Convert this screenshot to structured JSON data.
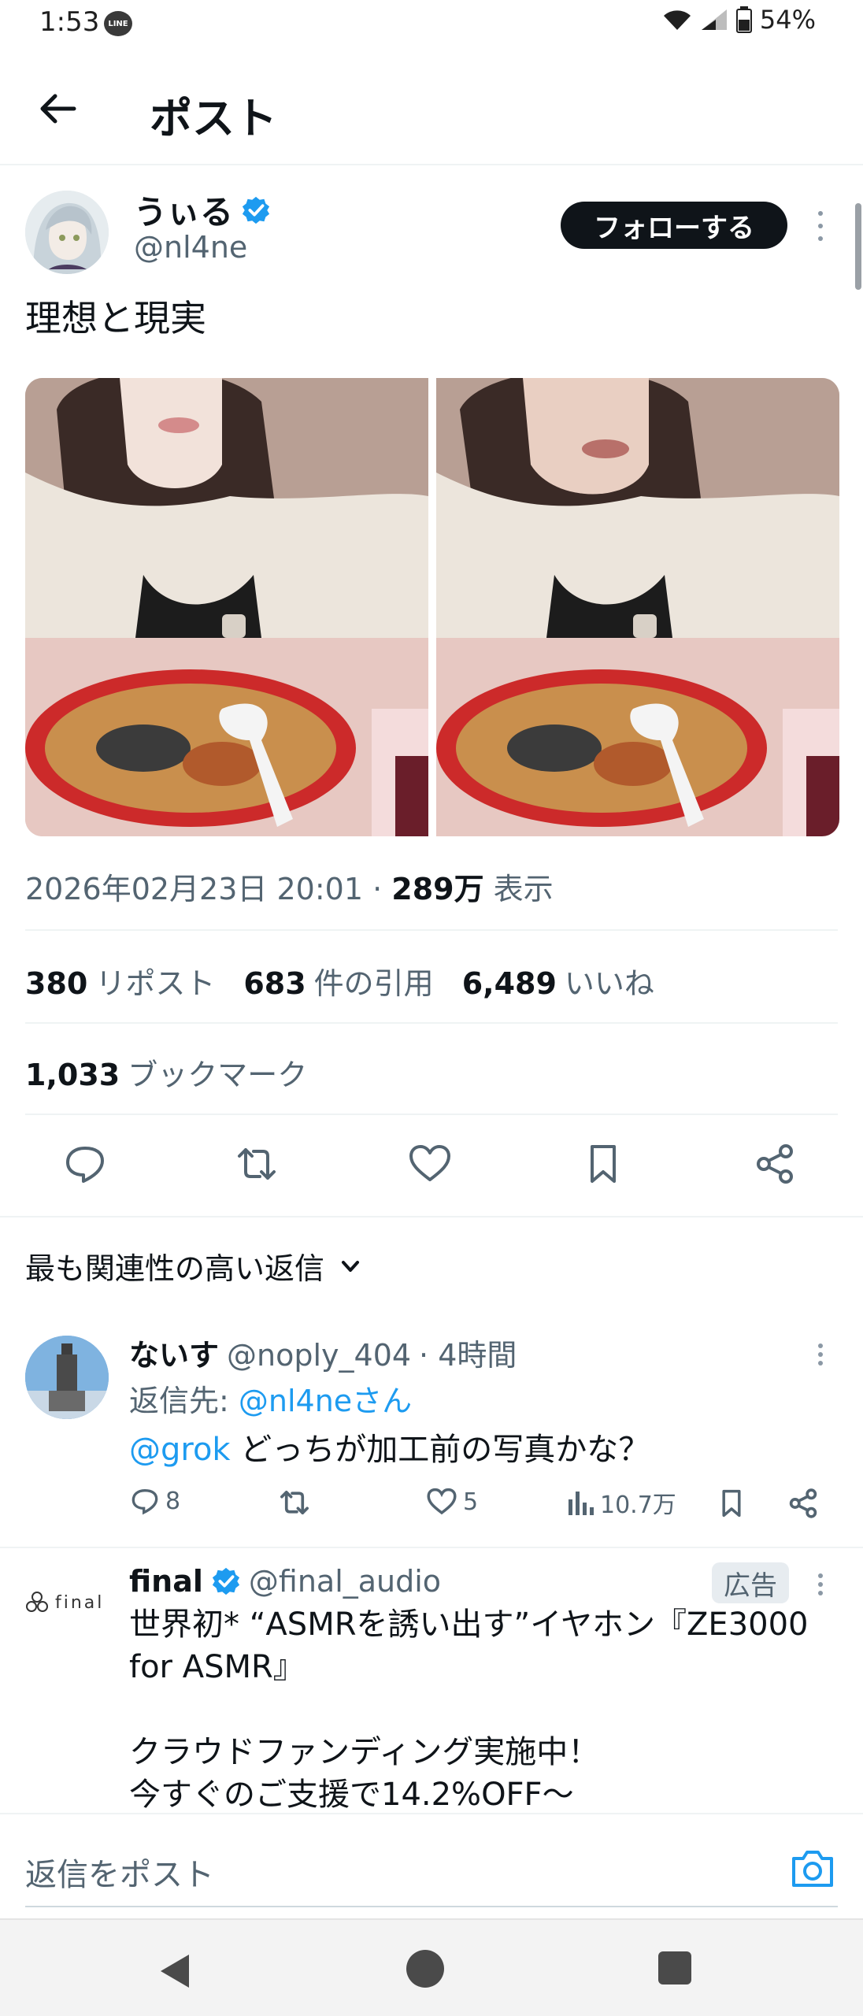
{
  "status_bar": {
    "time": "1:53",
    "line_icon_text": "LINE",
    "battery": "54%"
  },
  "header": {
    "title": "ポスト"
  },
  "post": {
    "author_name": "うぃる",
    "author_handle": "@nl4ne",
    "follow_label": "フォローする",
    "text": "理想と現実",
    "timestamp": "2026年02月23日 20:01 · ",
    "views_value": "289万",
    "views_label": " 表示",
    "stats": {
      "reposts_value": "380",
      "reposts_label": "リポスト",
      "quotes_value": "683",
      "quotes_label": "件の引用",
      "likes_value": "6,489",
      "likes_label": "いいね",
      "bookmarks_value": "1,033",
      "bookmarks_label": "ブックマーク"
    }
  },
  "replies_sort": {
    "label": "最も関連性の高い返信"
  },
  "reply": {
    "author_name": "ないす",
    "author_handle": "@noply_404",
    "time": "· 4時間",
    "reply_to_prefix": "返信先: ",
    "reply_to_handle": "@nl4neさん",
    "mention": "@grok",
    "text": " どっちが加工前の写真かな？",
    "reply_count": "8",
    "like_count": "5",
    "view_count": "10.7万"
  },
  "ad": {
    "logo_text": "final",
    "author_name": "final",
    "author_handle": "@final_audio",
    "badge": "広告",
    "body": "世界初* “ASMRを誘い出す”イヤホン『ZE3000 for ASMR』\n\nクラウドファンディング実施中！\n今すぐのご支援で14.2%OFF〜"
  },
  "compose": {
    "placeholder": "返信をポスト"
  },
  "colors": {
    "accent": "#1d9bf0",
    "text": "#0f1419",
    "muted": "#536471",
    "divider": "#eff3f4"
  }
}
